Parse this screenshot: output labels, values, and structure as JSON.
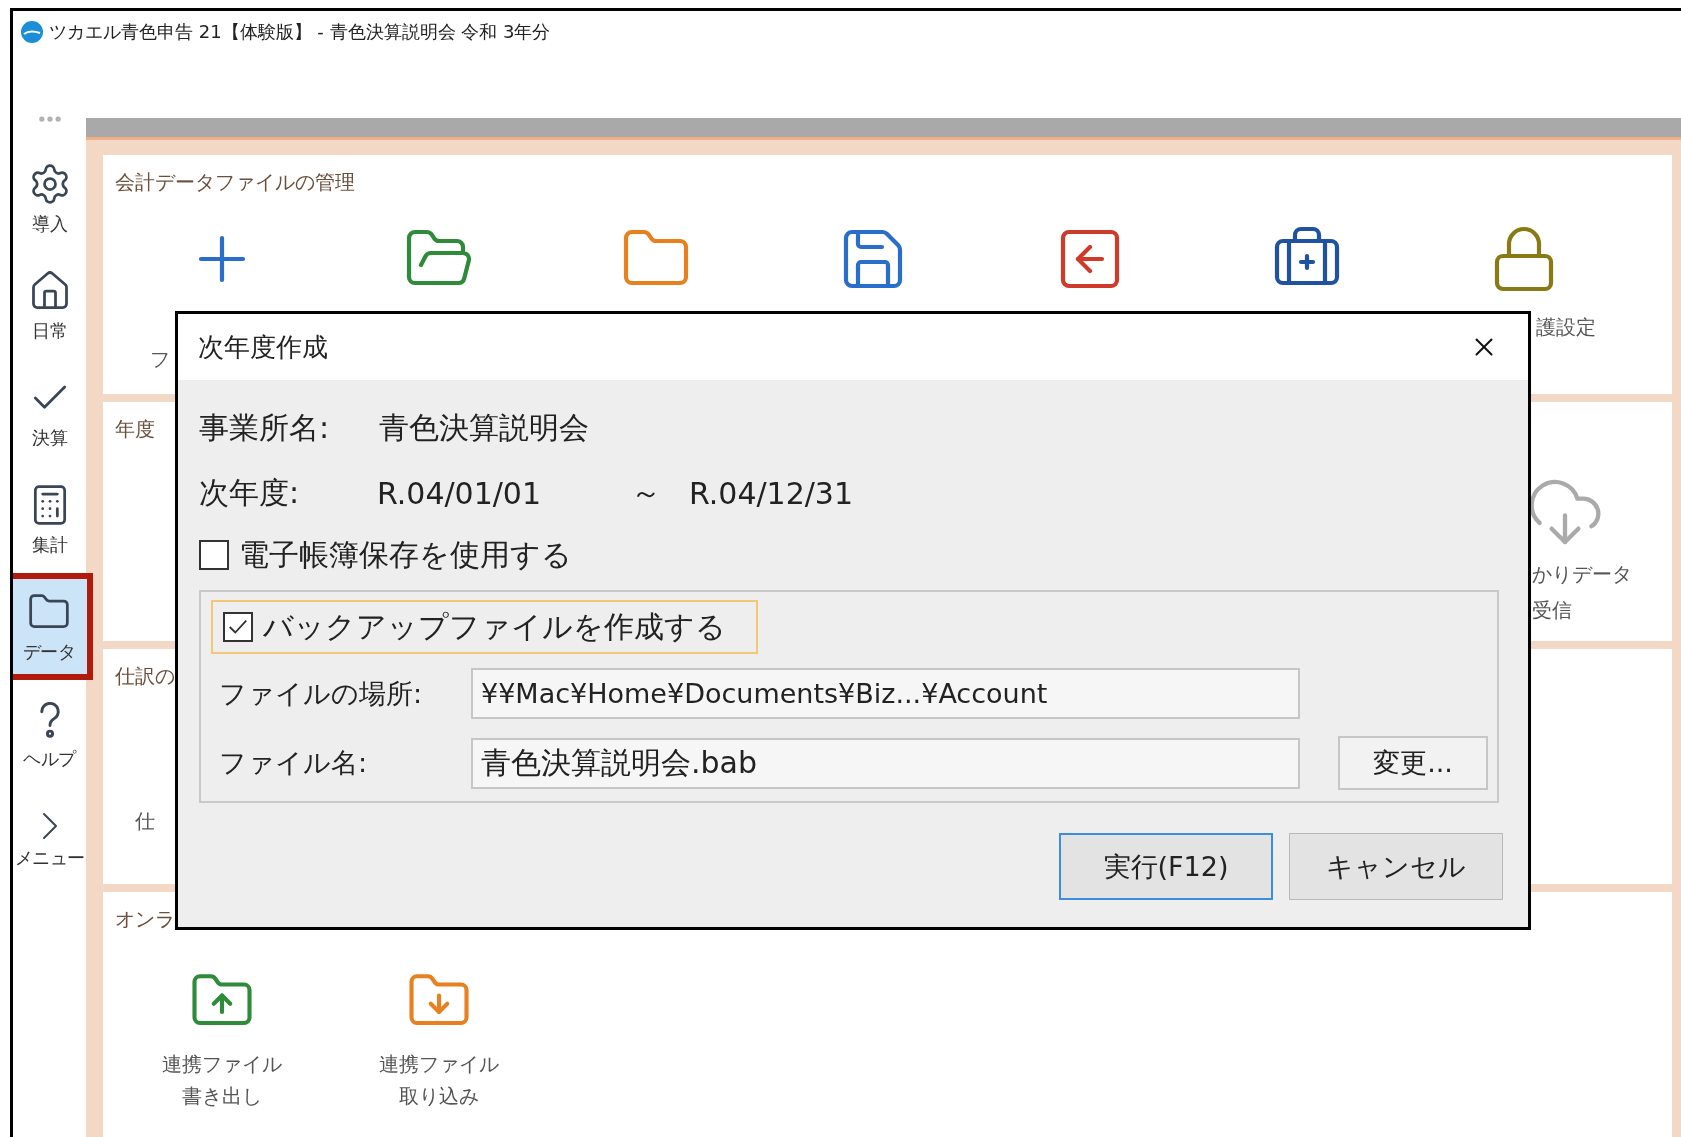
{
  "window": {
    "title": "ツカエル青色申告 21【体験版】 - 青色決算説明会 令和 3年分"
  },
  "sidebar": {
    "items": [
      {
        "label": "導入",
        "selected": false
      },
      {
        "label": "日常",
        "selected": false
      },
      {
        "label": "決算",
        "selected": false
      },
      {
        "label": "集計",
        "selected": false
      },
      {
        "label": "データ",
        "selected": true
      },
      {
        "label": "ヘルプ",
        "selected": false
      },
      {
        "label": "メニュー",
        "selected": false
      }
    ]
  },
  "sections": [
    {
      "title": "会計データファイルの管理",
      "labels": [
        {
          "lines": [
            "フ"
          ]
        },
        {
          "lines": [
            "護設定"
          ]
        }
      ]
    },
    {
      "title": "年度",
      "labels": [
        {
          "lines": [
            "かりデータ",
            "受信"
          ]
        }
      ]
    },
    {
      "title": "仕訳の",
      "labels": [
        {
          "lines": [
            "仕"
          ]
        }
      ]
    },
    {
      "title": "オンラ",
      "labels": [
        {
          "lines": [
            "連携ファイル",
            "書き出し"
          ]
        },
        {
          "lines": [
            "連携ファイル",
            "取り込み"
          ]
        }
      ]
    }
  ],
  "dialog": {
    "title": "次年度作成",
    "office_label": "事業所名:",
    "office_name": "青色決算説明会",
    "period_label": "次年度:",
    "period_start": "R.04/01/01",
    "period_sep": "～",
    "period_end": "R.04/12/31",
    "ebook_checkbox": {
      "label": "電子帳簿保存を使用する",
      "checked": false,
      "focused": false
    },
    "backup_checkbox": {
      "label": "バックアップファイルを作成する",
      "checked": true,
      "focused": true
    },
    "location_label": "ファイルの場所:",
    "location_value": "¥¥Mac¥Home¥Documents¥Biz...¥Account",
    "filename_label": "ファイル名:",
    "filename_value": "青色決算説明会.bab",
    "change_button": "変更...",
    "buttons": [
      {
        "label": "実行(F12)",
        "default": true
      },
      {
        "label": "キャンセル",
        "default": false
      }
    ]
  }
}
